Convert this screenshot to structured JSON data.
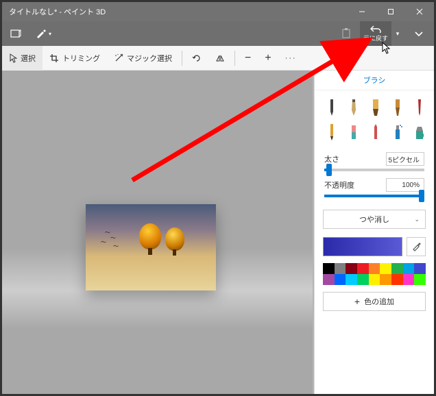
{
  "title": "タイトルなし* - ペイント 3D",
  "undo_label": "元に戻す",
  "toolbar": {
    "select": "選択",
    "trim": "トリミング",
    "magic": "マジック選択"
  },
  "sidebar": {
    "head": "ブラシ",
    "thickness_label": "太さ",
    "thickness_value": "5ピクセル",
    "opacity_label": "不透明度",
    "opacity_value": "100%",
    "finish": "つや消し",
    "add_color": "色の追加"
  },
  "palette": [
    "#000000",
    "#7f7f7f",
    "#880015",
    "#ed1c24",
    "#ff7f27",
    "#fff200",
    "#22b14c",
    "#00a2e8",
    "#3f48cc",
    "#ffffff",
    "#c3c3c3",
    "#b97a57",
    "#ffaec9",
    "#ffc90e",
    "#efe4b0",
    "#b5e61d",
    "#99d9ea",
    "#7092be",
    "#a349a4",
    "#ff00ff",
    "#00ffff",
    "#00ff00",
    "#ffff00",
    "#ff8000",
    "#ff0000",
    "#8000ff",
    "#0080ff"
  ]
}
